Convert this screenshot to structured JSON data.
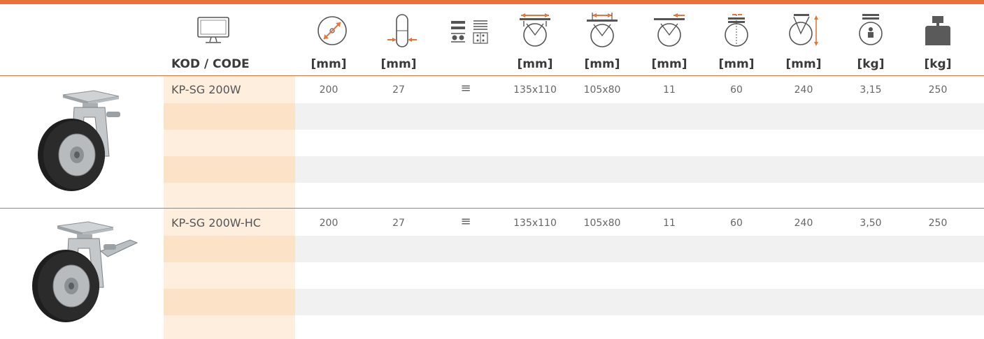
{
  "colors": {
    "accent": "#e8743b",
    "code_light": "#fdeedd",
    "code_dark": "#fce2c6",
    "stripe": "#f1f1f1"
  },
  "header": {
    "icons": [
      "monitor-icon",
      "wheel-diameter-icon",
      "tread-width-icon",
      "bearing-type-icon",
      "plate-size-icon",
      "bolt-hole-spacing-icon",
      "bolt-hole-diameter-icon",
      "offset-icon",
      "overall-height-icon",
      "weight-icon",
      "load-capacity-icon"
    ],
    "labels": [
      "KOD / CODE",
      "[mm]",
      "[mm]",
      "",
      "[mm]",
      "[mm]",
      "[mm]",
      "[mm]",
      "[mm]",
      "[kg]",
      "[kg]"
    ]
  },
  "products": [
    {
      "code": "KP-SG 200W",
      "image": "swivel-castor-image",
      "values": [
        "200",
        "27",
        "≡",
        "135x110",
        "105x80",
        "11",
        "60",
        "240",
        "3,15",
        "250"
      ]
    },
    {
      "code": "KP-SG 200W-HC",
      "image": "swivel-castor-with-brake-image",
      "values": [
        "200",
        "27",
        "≡",
        "135x110",
        "105x80",
        "11",
        "60",
        "240",
        "3,50",
        "250"
      ]
    }
  ]
}
